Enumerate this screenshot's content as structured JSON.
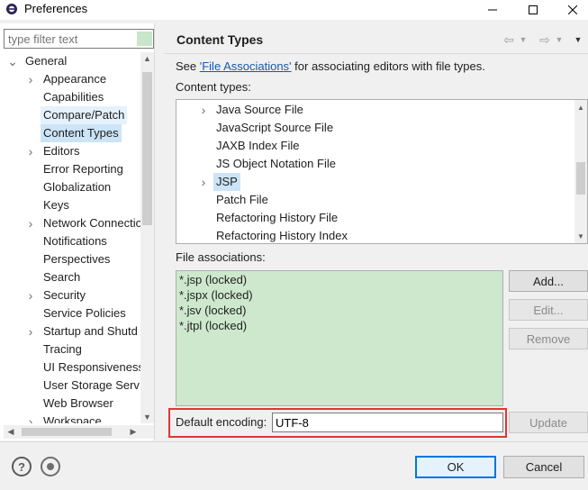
{
  "window": {
    "title": "Preferences",
    "icons": {
      "app": "eclipse-icon",
      "minimize": "minimize-icon",
      "maximize": "maximize-icon",
      "close": "close-icon"
    }
  },
  "left": {
    "filter_placeholder": "type filter text",
    "tree": [
      {
        "label": "General",
        "expander": "expanded",
        "depth": 0
      },
      {
        "label": "Appearance",
        "expander": "collapsed",
        "depth": 1
      },
      {
        "label": "Capabilities",
        "expander": "",
        "depth": 1
      },
      {
        "label": "Compare/Patch",
        "expander": "",
        "depth": 1,
        "state": "hover"
      },
      {
        "label": "Content Types",
        "expander": "",
        "depth": 1,
        "state": "selected"
      },
      {
        "label": "Editors",
        "expander": "collapsed",
        "depth": 1
      },
      {
        "label": "Error Reporting",
        "expander": "",
        "depth": 1
      },
      {
        "label": "Globalization",
        "expander": "",
        "depth": 1
      },
      {
        "label": "Keys",
        "expander": "",
        "depth": 1
      },
      {
        "label": "Network Connectio",
        "expander": "collapsed",
        "depth": 1
      },
      {
        "label": "Notifications",
        "expander": "",
        "depth": 1
      },
      {
        "label": "Perspectives",
        "expander": "",
        "depth": 1
      },
      {
        "label": "Search",
        "expander": "",
        "depth": 1
      },
      {
        "label": "Security",
        "expander": "collapsed",
        "depth": 1
      },
      {
        "label": "Service Policies",
        "expander": "",
        "depth": 1
      },
      {
        "label": "Startup and Shutd",
        "expander": "collapsed",
        "depth": 1
      },
      {
        "label": "Tracing",
        "expander": "",
        "depth": 1
      },
      {
        "label": "UI Responsiveness",
        "expander": "",
        "depth": 1
      },
      {
        "label": "User Storage Serv",
        "expander": "",
        "depth": 1
      },
      {
        "label": "Web Browser",
        "expander": "",
        "depth": 1
      },
      {
        "label": "Workspace",
        "expander": "collapsed",
        "depth": 1
      }
    ]
  },
  "page": {
    "title": "Content Types",
    "see_prefix": "See ",
    "see_link": "'File Associations'",
    "see_suffix": " for associating editors with file types.",
    "content_types_label": "Content types:",
    "content_types": [
      {
        "label": "Java Source File",
        "expander": "collapsed"
      },
      {
        "label": "JavaScript Source File",
        "expander": ""
      },
      {
        "label": "JAXB Index File",
        "expander": ""
      },
      {
        "label": "JS Object Notation File",
        "expander": ""
      },
      {
        "label": "JSP",
        "expander": "collapsed",
        "state": "selected"
      },
      {
        "label": "Patch File",
        "expander": ""
      },
      {
        "label": "Refactoring History File",
        "expander": ""
      },
      {
        "label": "Refactoring History Index",
        "expander": ""
      }
    ],
    "file_associations_label": "File associations:",
    "file_associations": [
      "*.jsp (locked)",
      "*.jspx (locked)",
      "*.jsv (locked)",
      "*.jtpl (locked)"
    ],
    "buttons": {
      "add": "Add...",
      "edit": "Edit...",
      "remove": "Remove",
      "update": "Update"
    },
    "encoding_label": "Default encoding:",
    "encoding_value": "UTF-8",
    "highlight_color": "#e03535"
  },
  "footer": {
    "ok": "OK",
    "cancel": "Cancel",
    "help": "?"
  }
}
